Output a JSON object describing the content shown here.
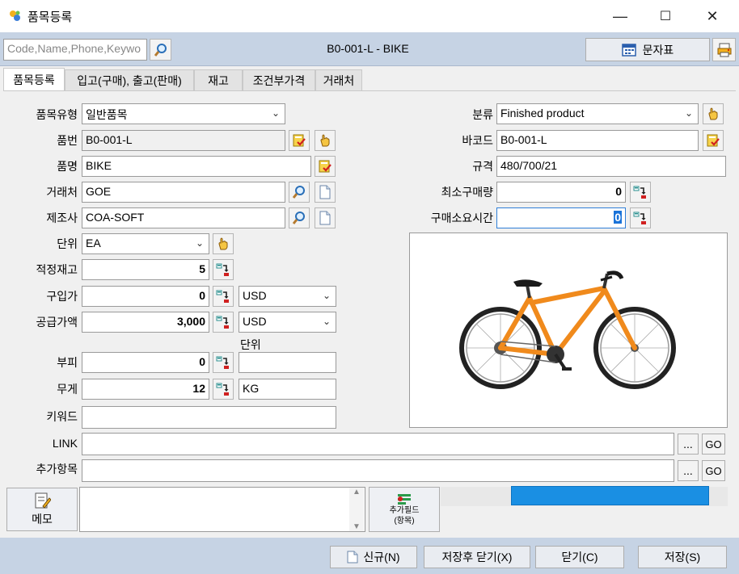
{
  "window": {
    "title": "품목등록",
    "minimize": "—",
    "maximize": "☐",
    "close": "✕"
  },
  "toolbar": {
    "search_placeholder": "Code,Name,Phone,Keywo",
    "record_title": "B0-001-L - BIKE",
    "sms_label": "문자표"
  },
  "tabs": [
    "품목등록",
    "입고(구매), 출고(판매)",
    "재고",
    "조건부가격",
    "거래처"
  ],
  "form": {
    "item_type_label": "품목유형",
    "item_type_value": "일반품목",
    "item_no_label": "품번",
    "item_no_value": "B0-001-L",
    "item_name_label": "품명",
    "item_name_value": "BIKE",
    "vendor_label": "거래처",
    "vendor_value": "GOE",
    "maker_label": "제조사",
    "maker_value": "COA-SOFT",
    "unit_label": "단위",
    "unit_value": "EA",
    "safety_stock_label": "적정재고",
    "safety_stock_value": "5",
    "purchase_price_label": "구입가",
    "purchase_price_value": "0",
    "purchase_currency": "USD",
    "supply_price_label": "공급가액",
    "supply_price_value": "3,000",
    "supply_currency": "USD",
    "volume_unit_label": "단위",
    "volume_label": "부피",
    "volume_value": "0",
    "volume_unit_value": "",
    "weight_label": "무게",
    "weight_value": "12",
    "weight_unit_value": "KG",
    "keyword_label": "키워드",
    "keyword_value": "",
    "link_label": "LINK",
    "link_value": "",
    "extra_label": "추가항목",
    "extra_value": "",
    "category_label": "분류",
    "category_value": "Finished product",
    "barcode_label": "바코드",
    "barcode_value": "B0-001-L",
    "spec_label": "규격",
    "spec_value": "480/700/21",
    "min_order_label": "최소구매량",
    "min_order_value": "0",
    "lead_time_label": "구매소요시간",
    "lead_time_value": "0"
  },
  "buttons": {
    "ellipsis": "...",
    "go": "GO",
    "memo": "메모",
    "add_field_line1": "추가필드",
    "add_field_line2": "(항목)",
    "new_label": "신규(N)",
    "save_close_label": "저장후 닫기(X)",
    "close_label": "닫기(C)",
    "save_label": "저장(S)"
  },
  "progress": {
    "value_fraction": 0.69
  },
  "colors": {
    "toolbar_bg": "#c6d3e4",
    "progress": "#1a8fe3",
    "bike_frame": "#f08a1c"
  },
  "icons": {
    "app": "app-icon",
    "search": "magnifier-icon",
    "calendar": "calendar-grid-icon",
    "print": "printer-icon",
    "check_doc": "check-document-icon",
    "hand": "hand-pointer-icon",
    "doc": "blank-document-icon",
    "calc": "calculator-arrow-icon",
    "memo": "memo-edit-icon",
    "add_field": "add-field-icon"
  }
}
